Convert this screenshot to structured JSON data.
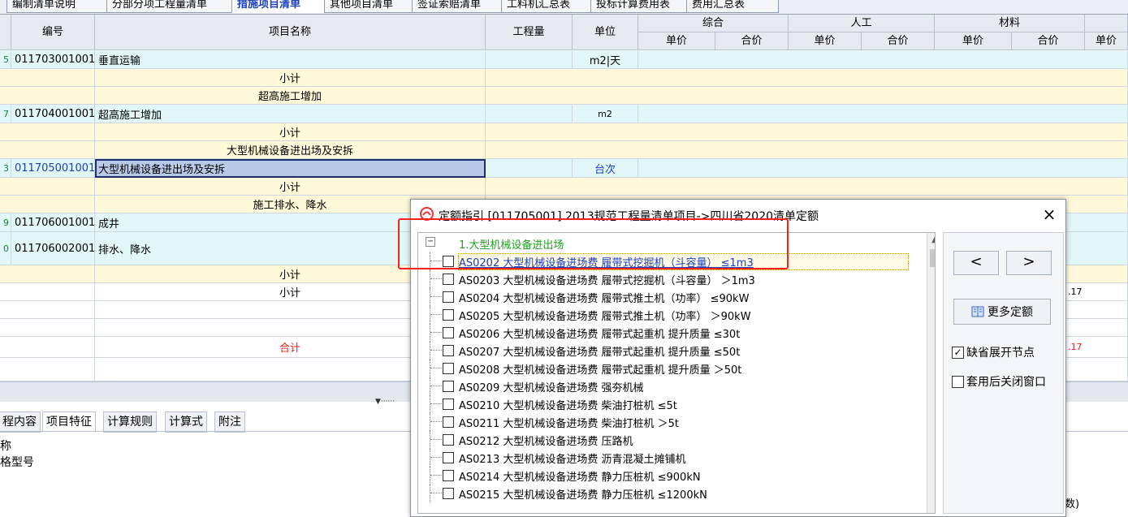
{
  "top_tabs": [
    "编制清单说明",
    "分部分项工程量清单",
    "措施项目清单",
    "其他项目清单",
    "签证索赔清单",
    "工料机汇总表",
    "投标计算费用表",
    "费用汇总表"
  ],
  "grid_header": {
    "code": "编号",
    "name": "项目名称",
    "qty": "工程量",
    "unit": "单位",
    "groups": [
      "综合",
      "人工",
      "材料"
    ],
    "unit_price": "单价",
    "total_price": "合价",
    "last_unit_price": "单价"
  },
  "rows": [
    {
      "num": "5",
      "code": "011703001001",
      "name": "垂直运输",
      "unit": "m2|天",
      "type": "item"
    },
    {
      "num": "",
      "code": "",
      "name": "小计",
      "unit": "",
      "type": "sub"
    },
    {
      "num": "",
      "code": "",
      "name": "超高施工增加",
      "unit": "",
      "type": "sub"
    },
    {
      "num": "7",
      "code": "011704001001",
      "name": "超高施工增加",
      "unit": "m2",
      "type": "item"
    },
    {
      "num": "",
      "code": "",
      "name": "小计",
      "unit": "",
      "type": "sub"
    },
    {
      "num": "",
      "code": "",
      "name": "大型机械设备进出场及安拆",
      "unit": "",
      "type": "sub"
    },
    {
      "num": "3",
      "code": "011705001001",
      "name": "大型机械设备进出场及安拆",
      "unit": "台次",
      "type": "selected"
    },
    {
      "num": "",
      "code": "",
      "name": "小计",
      "unit": "",
      "type": "sub"
    },
    {
      "num": "",
      "code": "",
      "name": "施工排水、降水",
      "unit": "",
      "type": "sub"
    },
    {
      "num": "9",
      "code": "011706001001",
      "name": "成井",
      "unit": "",
      "type": "item"
    },
    {
      "num": "0",
      "code": "011706002001",
      "name": "排水、降水",
      "unit": "",
      "type": "itemtall"
    },
    {
      "num": "",
      "code": "",
      "name": "小计",
      "unit": "",
      "type": "sub"
    },
    {
      "num": "",
      "code": "",
      "name": "小计",
      "unit": "",
      "type": "sub"
    },
    {
      "num": "",
      "code": "",
      "name": "",
      "unit": "",
      "type": "blank"
    },
    {
      "num": "",
      "code": "",
      "name": "",
      "unit": "",
      "type": "blank"
    },
    {
      "num": "",
      "code": "",
      "name": "合计",
      "unit": "",
      "type": "total"
    },
    {
      "num": "",
      "code": "",
      "name": "",
      "unit": "",
      "type": "blank"
    }
  ],
  "right_values": {
    "r1": ".17",
    "r2": ".17"
  },
  "bottom_tabs": [
    "程内容",
    "项目特征",
    "计算规则",
    "计算式",
    "附注"
  ],
  "features": [
    "称",
    "格型号"
  ],
  "bottom_right_text": "数)",
  "dialog": {
    "title": "定额指引 [011705001]  2013规范工程量清单项目->四川省2020清单定额",
    "root_label": "1.大型机械设备进出场",
    "items": [
      "AS0202 大型机械设备进场费 履带式挖掘机（斗容量） ≤1m3",
      "AS0203 大型机械设备进场费 履带式挖掘机（斗容量） ＞1m3",
      "AS0204 大型机械设备进场费 履带式推土机（功率） ≤90kW",
      "AS0205 大型机械设备进场费 履带式推土机（功率） ＞90kW",
      "AS0206 大型机械设备进场费 履带式起重机 提升质量 ≤30t",
      "AS0207 大型机械设备进场费 履带式起重机 提升质量 ≤50t",
      "AS0208 大型机械设备进场费 履带式起重机 提升质量 ＞50t",
      "AS0209 大型机械设备进场费 强夯机械",
      "AS0210 大型机械设备进场费 柴油打桩机 ≤5t",
      "AS0211 大型机械设备进场费 柴油打桩机 ＞5t",
      "AS0212 大型机械设备进场费 压路机",
      "AS0213 大型机械设备进场费 沥青混凝土摊铺机",
      "AS0214 大型机械设备进场费 静力压桩机 ≤900kN",
      "AS0215 大型机械设备进场费 静力压桩机 ≤1200kN"
    ],
    "prev": "<",
    "next": ">",
    "more_label": "更多定额",
    "opt_expand": "缺省展开节点",
    "opt_close": "套用后关闭窗口",
    "opt_expand_checked": true,
    "opt_close_checked": false,
    "close": "×"
  }
}
